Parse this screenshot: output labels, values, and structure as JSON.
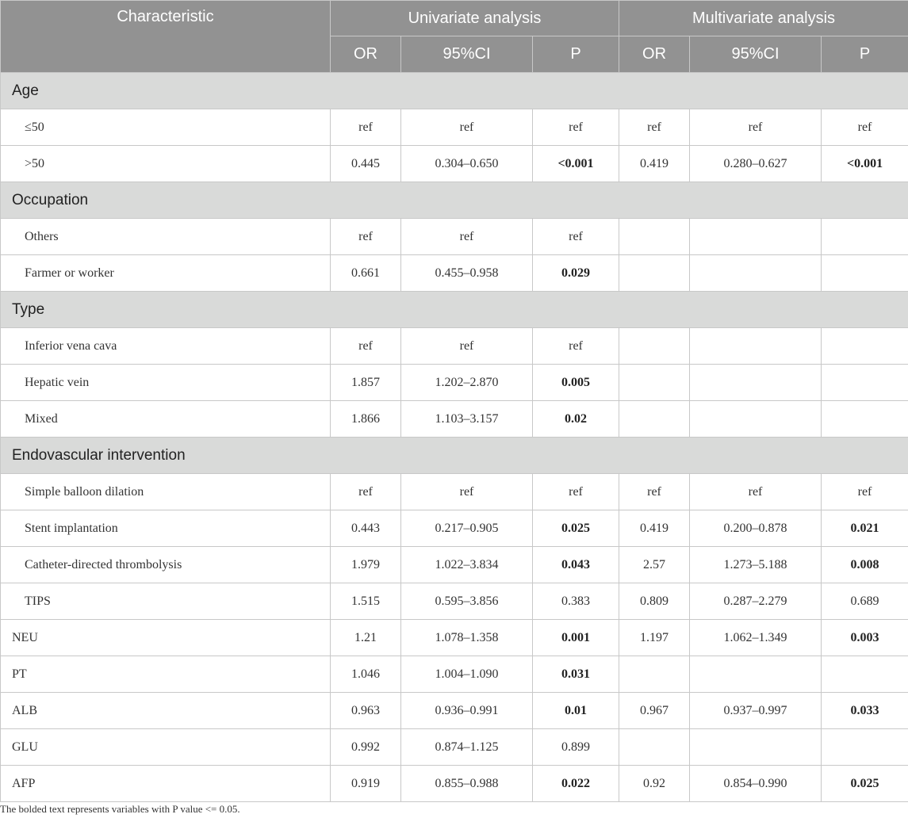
{
  "header": {
    "characteristic": "Characteristic",
    "univariate": "Univariate analysis",
    "multivariate": "Multivariate analysis",
    "subcols": [
      "OR",
      "95%CI",
      "P",
      "OR",
      "95%CI",
      "P"
    ]
  },
  "rows": [
    {
      "kind": "group",
      "label": "Age"
    },
    {
      "kind": "row",
      "indent": true,
      "label": "≤50",
      "cells": [
        "ref",
        "ref",
        "ref",
        "ref",
        "ref",
        "ref"
      ],
      "bold": []
    },
    {
      "kind": "row",
      "indent": true,
      "label": ">50",
      "cells": [
        "0.445",
        "0.304–0.650",
        "<0.001",
        "0.419",
        "0.280–0.627",
        "<0.001"
      ],
      "bold": [
        2,
        5
      ]
    },
    {
      "kind": "group",
      "label": "Occupation"
    },
    {
      "kind": "row",
      "indent": true,
      "label": "Others",
      "cells": [
        "ref",
        "ref",
        "ref",
        "",
        "",
        ""
      ],
      "bold": []
    },
    {
      "kind": "row",
      "indent": true,
      "label": "Farmer or worker",
      "cells": [
        "0.661",
        "0.455–0.958",
        "0.029",
        "",
        "",
        ""
      ],
      "bold": [
        2
      ]
    },
    {
      "kind": "group",
      "label": "Type"
    },
    {
      "kind": "row",
      "indent": true,
      "label": "Inferior vena cava",
      "cells": [
        "ref",
        "ref",
        "ref",
        "",
        "",
        ""
      ],
      "bold": []
    },
    {
      "kind": "row",
      "indent": true,
      "label": "Hepatic vein",
      "cells": [
        "1.857",
        "1.202–2.870",
        "0.005",
        "",
        "",
        ""
      ],
      "bold": [
        2
      ]
    },
    {
      "kind": "row",
      "indent": true,
      "label": "Mixed",
      "cells": [
        "1.866",
        "1.103–3.157",
        "0.02",
        "",
        "",
        ""
      ],
      "bold": [
        2
      ]
    },
    {
      "kind": "group",
      "label": "Endovascular intervention"
    },
    {
      "kind": "row",
      "indent": true,
      "label": "Simple balloon dilation",
      "cells": [
        "ref",
        "ref",
        "ref",
        "ref",
        "ref",
        "ref"
      ],
      "bold": []
    },
    {
      "kind": "row",
      "indent": true,
      "label": "Stent implantation",
      "cells": [
        "0.443",
        "0.217–0.905",
        "0.025",
        "0.419",
        "0.200–0.878",
        "0.021"
      ],
      "bold": [
        2,
        5
      ]
    },
    {
      "kind": "row",
      "indent": true,
      "label": "Catheter-directed thrombolysis",
      "cells": [
        "1.979",
        "1.022–3.834",
        "0.043",
        "2.57",
        "1.273–5.188",
        "0.008"
      ],
      "bold": [
        2,
        5
      ]
    },
    {
      "kind": "row",
      "indent": true,
      "label": "TIPS",
      "cells": [
        "1.515",
        "0.595–3.856",
        "0.383",
        "0.809",
        "0.287–2.279",
        "0.689"
      ],
      "bold": []
    },
    {
      "kind": "row",
      "indent": false,
      "label": "NEU",
      "cells": [
        "1.21",
        "1.078–1.358",
        "0.001",
        "1.197",
        "1.062–1.349",
        "0.003"
      ],
      "bold": [
        2,
        5
      ]
    },
    {
      "kind": "row",
      "indent": false,
      "label": "PT",
      "cells": [
        "1.046",
        "1.004–1.090",
        "0.031",
        "",
        "",
        ""
      ],
      "bold": [
        2
      ]
    },
    {
      "kind": "row",
      "indent": false,
      "label": "ALB",
      "cells": [
        "0.963",
        "0.936–0.991",
        "0.01",
        "0.967",
        "0.937–0.997",
        "0.033"
      ],
      "bold": [
        2,
        5
      ]
    },
    {
      "kind": "row",
      "indent": false,
      "label": "GLU",
      "cells": [
        "0.992",
        "0.874–1.125",
        "0.899",
        "",
        "",
        ""
      ],
      "bold": []
    },
    {
      "kind": "row",
      "indent": false,
      "label": "AFP",
      "cells": [
        "0.919",
        "0.855–0.988",
        "0.022",
        "0.92",
        "0.854–0.990",
        "0.025"
      ],
      "bold": [
        2,
        5
      ]
    }
  ],
  "footnote": "The bolded text represents variables with P value <= 0.05.",
  "colors": {
    "header_bg": "#929292",
    "group_bg": "#d9dad9",
    "border": "#c8c8c8"
  }
}
